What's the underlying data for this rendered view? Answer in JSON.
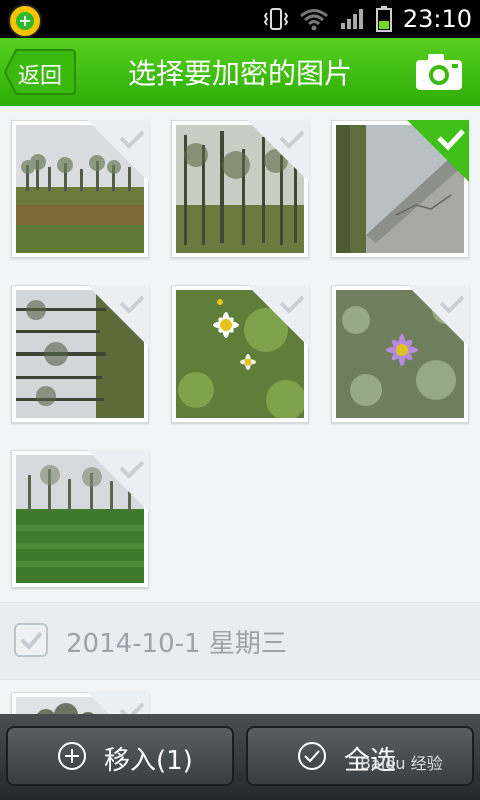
{
  "status_bar": {
    "time": "23:10"
  },
  "header": {
    "back_label": "返回",
    "title": "选择要加密的图片"
  },
  "photos": [
    {
      "scene": "field-trees",
      "selected": false
    },
    {
      "scene": "grove",
      "selected": false
    },
    {
      "scene": "rotated-wall",
      "selected": true
    },
    {
      "scene": "rotated-trees",
      "selected": false
    },
    {
      "scene": "daisies",
      "selected": false
    },
    {
      "scene": "purple-flower",
      "selected": false
    },
    {
      "scene": "green-field",
      "selected": false
    }
  ],
  "section": {
    "date_label": "2014-10-1 星期三"
  },
  "bottom": {
    "move_in_label": "移入(1)",
    "select_all_label": "全选"
  },
  "watermark": "Baidu 经验",
  "colors": {
    "accent": "#2fae08",
    "check_selected": "#3fbf17"
  }
}
